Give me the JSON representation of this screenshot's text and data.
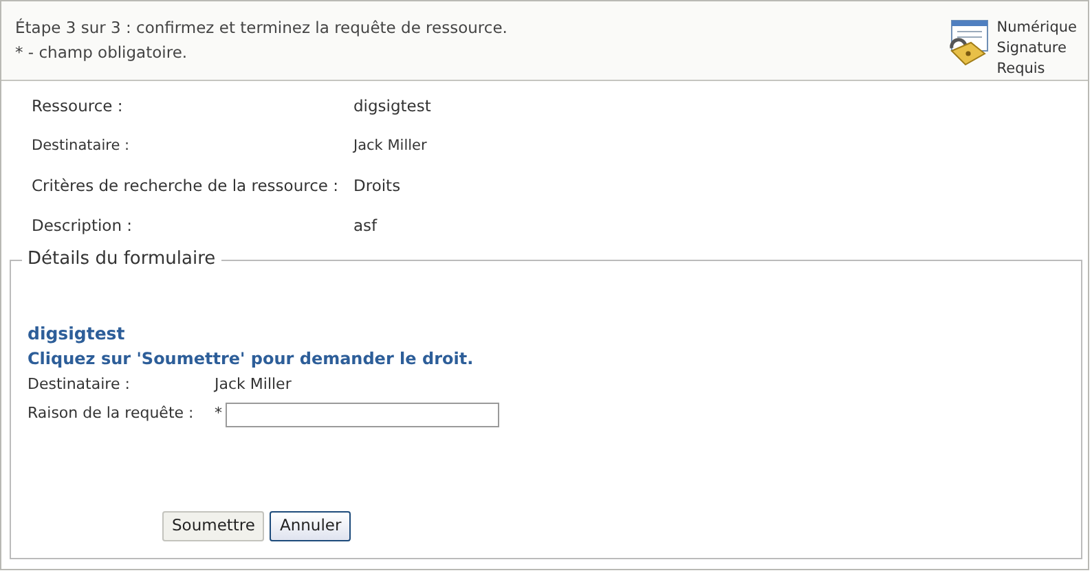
{
  "header": {
    "instruction": "Étape 3 sur 3 : confirmez et terminez la requête de ressource.",
    "required_note": "* - champ obligatoire.",
    "badge_lines": [
      "Numérique",
      "Signature",
      "Requis"
    ]
  },
  "summary": [
    {
      "label": "Ressource :",
      "value": "digsigtest",
      "small": false
    },
    {
      "label": "Destinataire :",
      "value": "Jack Miller",
      "small": true
    },
    {
      "label": "Critères de recherche de la ressource :",
      "value": "Droits",
      "small": false
    },
    {
      "label": "Description :",
      "value": "asf",
      "small": false
    }
  ],
  "form": {
    "legend": "Détails du formulaire",
    "title": "digsigtest",
    "subtitle": "Cliquez sur 'Soumettre' pour demander le droit.",
    "recipient": {
      "label": "Destinataire :",
      "value": "Jack Miller"
    },
    "reason": {
      "label": "Raison de la requête :",
      "required_mark": "*"
    },
    "buttons": [
      {
        "label": "Soumettre",
        "default": false
      },
      {
        "label": "Annuler",
        "default": true
      }
    ]
  }
}
